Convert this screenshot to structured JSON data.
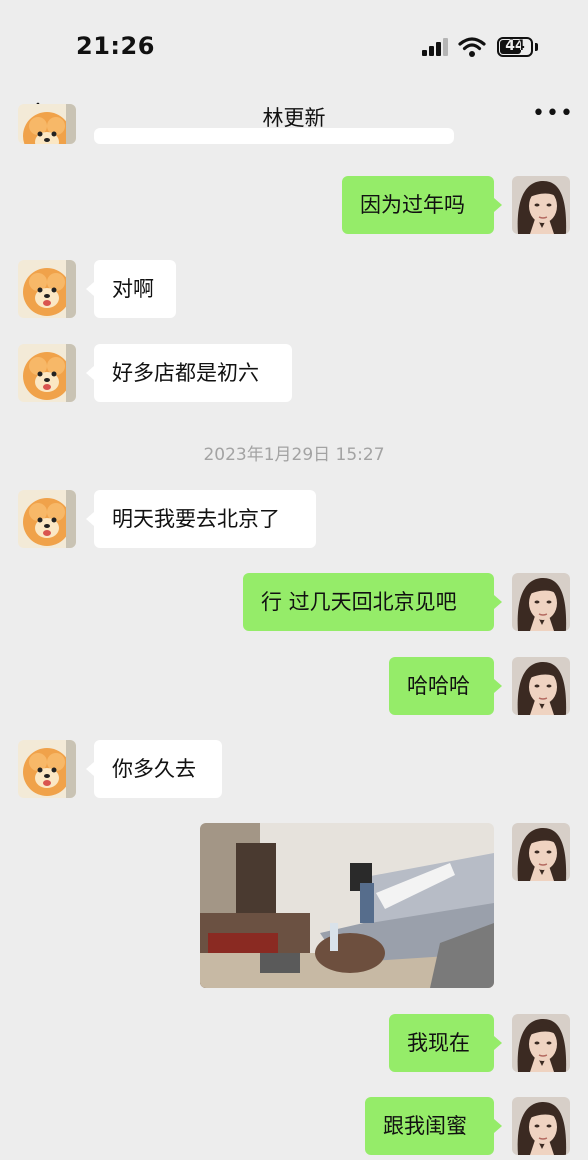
{
  "status": {
    "time": "21:26",
    "battery": "44"
  },
  "nav": {
    "title": "林更新",
    "more": "•••"
  },
  "messages": {
    "m1": "因为过年吗",
    "m2": "对啊",
    "m3": "好多店都是初六",
    "timestamp": "2023年1月29日 15:27",
    "m4": "明天我要去北京了",
    "m5": "行 过几天回北京见吧",
    "m6": "哈哈哈",
    "m7": "你多久去",
    "m9": "我现在",
    "m10": "跟我闺蜜"
  },
  "colors": {
    "sent_bubble": "#95ec69",
    "received_bubble": "#ffffff",
    "background": "#ededed"
  },
  "icons": {
    "back": "chevron-left-icon",
    "more": "more-dots-icon",
    "signal": "cellular-signal-icon",
    "wifi": "wifi-icon",
    "battery": "battery-icon"
  }
}
